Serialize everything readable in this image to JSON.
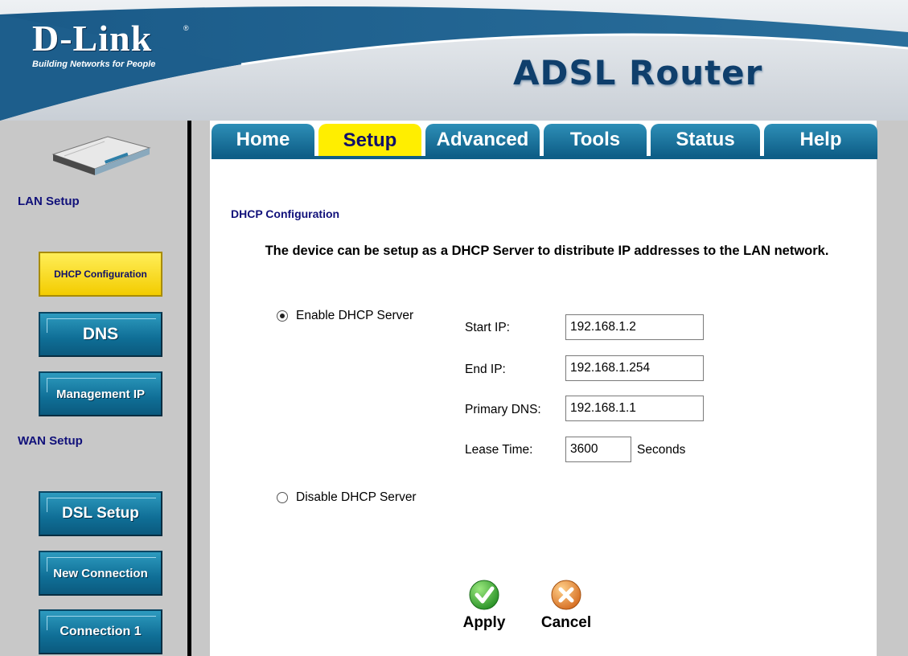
{
  "brand": {
    "logo_text": "D-Link",
    "registered_mark": "®",
    "tagline": "Building Networks for People",
    "product_title": "ADSL Router"
  },
  "tabs": [
    {
      "label": "Home",
      "active": false
    },
    {
      "label": "Setup",
      "active": true
    },
    {
      "label": "Advanced",
      "active": false
    },
    {
      "label": "Tools",
      "active": false
    },
    {
      "label": "Status",
      "active": false
    },
    {
      "label": "Help",
      "active": false
    }
  ],
  "sidebar": {
    "lan_heading": "LAN Setup",
    "wan_heading": "WAN Setup",
    "buttons": [
      {
        "label": "DHCP Configuration",
        "active": true
      },
      {
        "label": "DNS",
        "active": false
      },
      {
        "label": "Management IP",
        "active": false
      },
      {
        "label": "DSL Setup",
        "active": false
      },
      {
        "label": "New Connection",
        "active": false
      },
      {
        "label": "Connection 1",
        "active": false
      }
    ]
  },
  "main": {
    "page_title": "DHCP Configuration",
    "description": "The device can be setup as a DHCP Server to distribute IP addresses to the LAN network.",
    "enable_label": "Enable DHCP Server",
    "disable_label": "Disable DHCP Server",
    "selected_mode": "enable",
    "fields": {
      "start_ip": {
        "label": "Start IP:",
        "value": "192.168.1.2"
      },
      "end_ip": {
        "label": "End IP:",
        "value": "192.168.1.254"
      },
      "primary_dns": {
        "label": "Primary DNS:",
        "value": "192.168.1.1"
      },
      "lease_time": {
        "label": "Lease Time:",
        "value": "3600",
        "unit": "Seconds"
      }
    },
    "apply_label": "Apply",
    "cancel_label": "Cancel"
  },
  "colors": {
    "banner_blue": "#1d5e8c",
    "tab_blue": "#1478a6",
    "active_yellow": "#ffee00",
    "heading_navy": "#11117a",
    "panel_gray": "#c8c8c8",
    "apply_green": "#2e9d2e",
    "cancel_orange": "#e8862a"
  },
  "icons": {
    "apply": "checkmark-icon",
    "cancel": "x-icon",
    "device": "router-icon"
  }
}
